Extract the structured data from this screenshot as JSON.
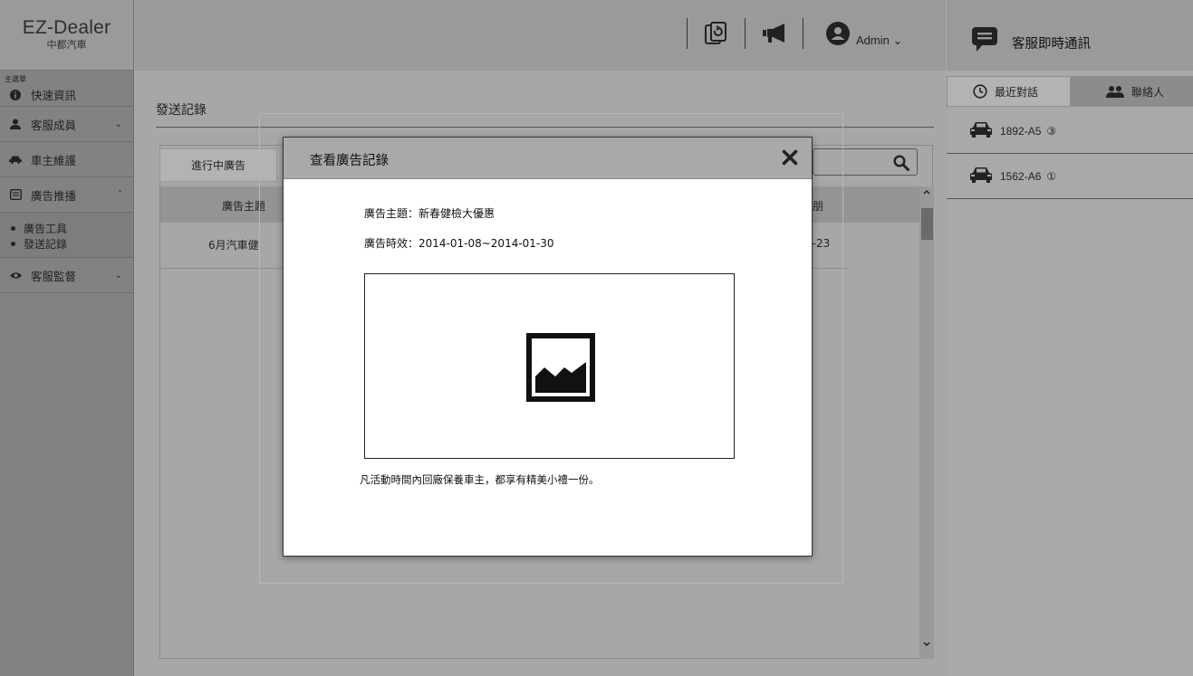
{
  "app": {
    "brand": "EZ-Dealer",
    "subtitle": "中都汽車"
  },
  "sidebar": {
    "menu_title": "主選單",
    "items": [
      {
        "label": "快速資訊",
        "icon": "info-icon"
      },
      {
        "label": "客服成員",
        "icon": "user-icon",
        "chevron": "⌄"
      },
      {
        "label": "車主維護",
        "icon": "car-icon"
      },
      {
        "label": "廣告推播",
        "icon": "newspaper-icon",
        "chevron": "˅"
      },
      {
        "label": "客服監督",
        "icon": "eye-icon",
        "chevron": "⌄"
      }
    ],
    "subitems": [
      {
        "label": "廣告工具"
      },
      {
        "label": "發送記錄"
      }
    ]
  },
  "topbar": {
    "admin_label": "Admin ⌄"
  },
  "main": {
    "page_title": "發送記錄",
    "tab_active": "進行中廣告",
    "table": {
      "header_topic": "廣告主題",
      "header_date_fragment": "朋",
      "row1_topic": "6月汽車健",
      "row1_date_fragment": "1-23"
    }
  },
  "modal": {
    "title": "查看廣告記錄",
    "topic": "廣告主題：新春健檢大優惠",
    "period": "廣告時效：2014-01-08~2014-01-30",
    "description": "凡活動時間內回廠保養車主，都享有精美小禮一份。"
  },
  "chat": {
    "title": "客服即時通訊",
    "tab_recent": "最近對話",
    "tab_contacts": "聯絡人",
    "items": [
      {
        "plate": "1892-A5",
        "badge": "③"
      },
      {
        "plate": "1562-A6",
        "badge": "①"
      }
    ]
  }
}
